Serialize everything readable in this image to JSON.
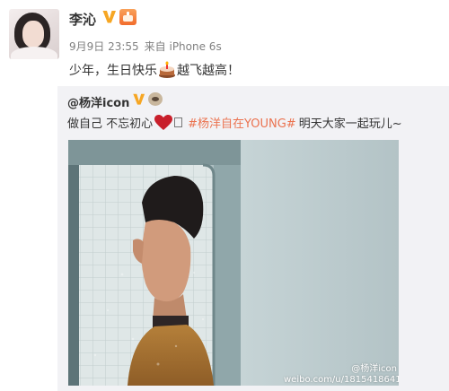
{
  "post": {
    "author": "李沁",
    "timestamp": "9月9日 23:55",
    "source": "来自 iPhone 6s",
    "text_before": "少年，生日快乐",
    "text_after": "越飞越高！",
    "icons": [
      "avatar",
      "verified-v-icon",
      "member-badge-icon",
      "birthday-cake-emoji"
    ]
  },
  "repost": {
    "author": "@杨洋icon",
    "text_before": "做自己 不忘初心",
    "hashtag": "#杨洋自在YOUNG#",
    "text_after": "明天大家一起玩儿~",
    "watermark_line1": "@杨洋icon",
    "watermark_line2": "weibo.com/u/1815418641",
    "colors": {
      "hashtag": "#eb7350",
      "background": "#f2f2f5",
      "verified": "#f6a623"
    }
  }
}
